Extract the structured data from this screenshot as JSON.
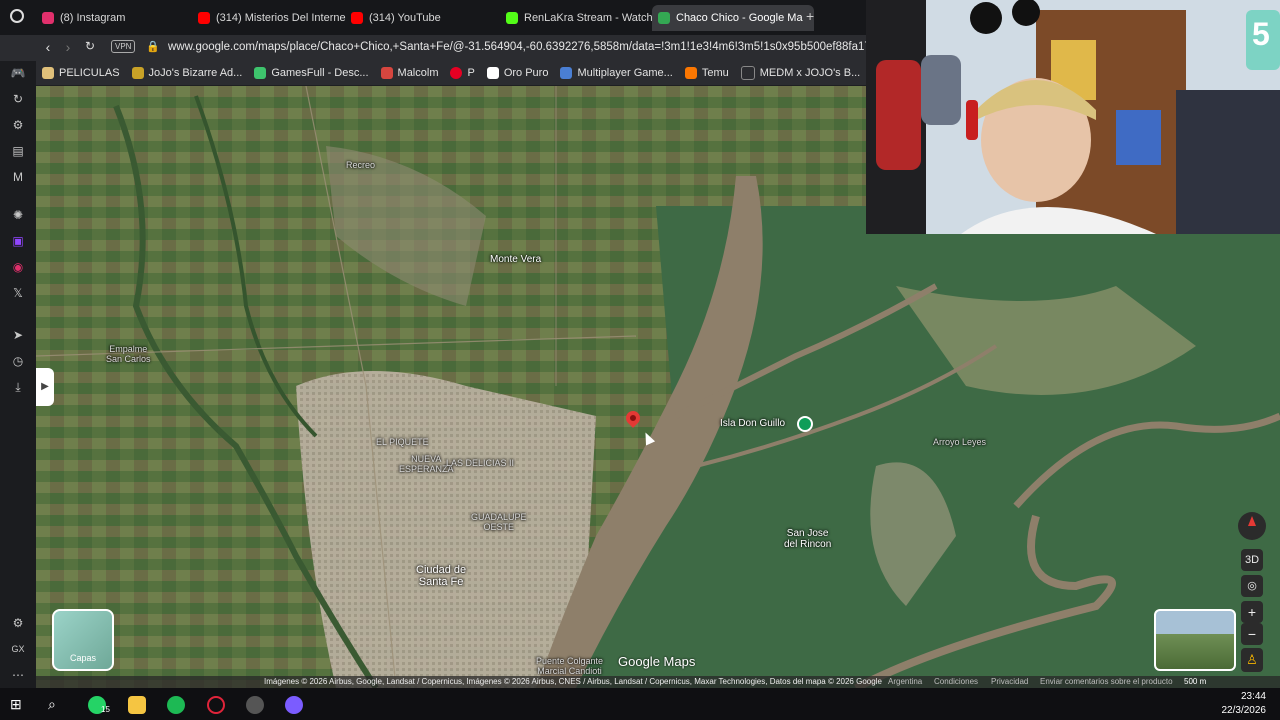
{
  "tabs": [
    {
      "label": "(8) Instagram",
      "color": "#e1306c"
    },
    {
      "label": "(314) Misterios Del Interne",
      "color": "#ff0000"
    },
    {
      "label": "(314) YouTube",
      "color": "#ff0000"
    },
    {
      "label": "RenLaKra Stream - Watch",
      "color": "#53fc18"
    },
    {
      "label": "Chaco Chico - Google Ma",
      "color": "#34a853",
      "active": true
    }
  ],
  "new_tab": "+",
  "address": {
    "vpn": "VPN",
    "url": "www.google.com/maps/place/Chaco+Chico,+Santa+Fe/@-31.564904,-60.6392276,5858m/data=!3m1!1e3!4m6!3m5!1s0x95b500ef88fa17b3:"
  },
  "bookmarks": [
    {
      "label": "PELICULAS",
      "color": "#e0c07a"
    },
    {
      "label": "JoJo's Bizarre Ad...",
      "color": "#c9a227"
    },
    {
      "label": "GamesFull - Desc...",
      "color": "#3ec46d"
    },
    {
      "label": "Malcolm",
      "color": "#d6463f"
    },
    {
      "label": "P",
      "color": "#e60023"
    },
    {
      "label": "Oro Puro",
      "color": "#ffffff"
    },
    {
      "label": "Multiplayer Game...",
      "color": "#4a7fd4"
    },
    {
      "label": "Temu",
      "color": "#fb7701"
    },
    {
      "label": "MEDM x JOJO's B...",
      "color": "#2b2c30"
    }
  ],
  "map": {
    "labels": {
      "monte_vera": "Monte Vera",
      "empalme": "Empalme\nSan Carlos",
      "piquete": "EL PIQUETE",
      "nueva_esperanza": "NUEVA\nESPERANZA",
      "las_delicias": "LAS DELICIAS II",
      "guadalupe": "GUADALUPE\nOESTE",
      "santa_fe": "Ciudad de\nSanta Fe",
      "isla": "Isla Don Guillo",
      "arroyo": "Arroyo Leyes",
      "san_jose": "San Jose\ndel Rincon",
      "puente": "Puente Colgante\nMarcial Candioti",
      "recreo": "Recreo"
    },
    "layers_label": "Capas",
    "three_d": "3D",
    "zoom_in": "+",
    "zoom_out": "−",
    "logo": "Google Maps",
    "attribution": "Imágenes © 2026 Airbus, Google, Landsat / Copernicus, Imágenes © 2026 Airbus, CNES / Airbus, Landsat / Copernicus, Maxar Technologies, Datos del mapa © 2026 Google",
    "links": [
      "Argentina",
      "Condiciones",
      "Privacidad",
      "Enviar comentarios sobre el producto"
    ],
    "scale": "500 m"
  },
  "webcam": {
    "badge": "5"
  },
  "taskbar": {
    "whatsapp_badge": "15",
    "time": "23:44",
    "date": "22/3/2026"
  },
  "colors": {
    "farmland": "#4f6e3c",
    "city": "#b7ad9c",
    "river": "#8e7f6a",
    "wetland": "#3f6a45"
  }
}
